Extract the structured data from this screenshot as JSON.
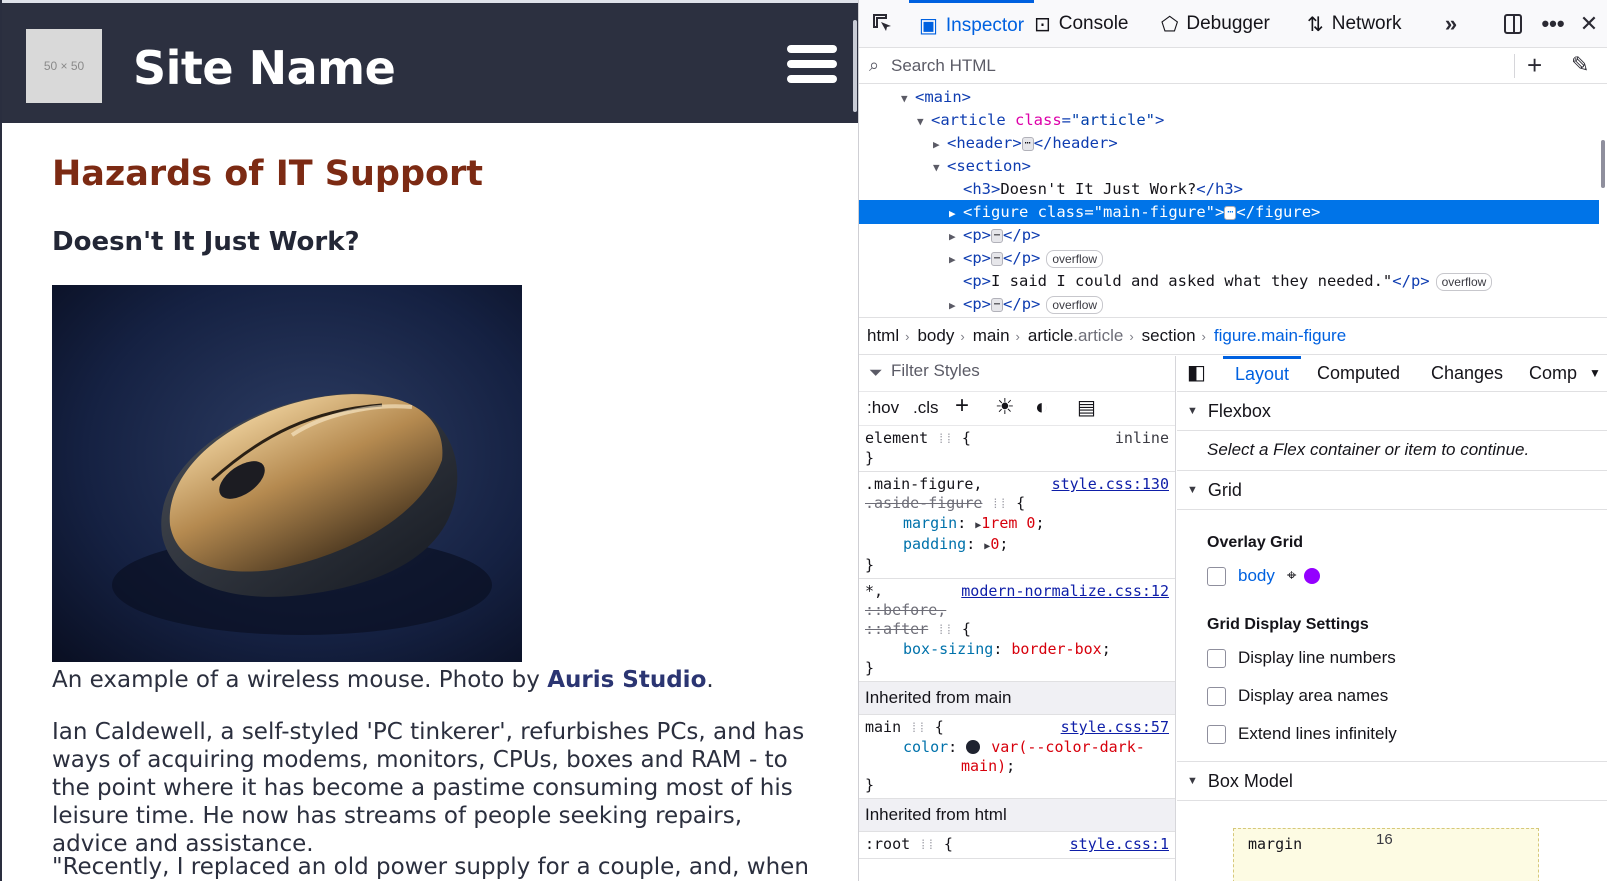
{
  "page": {
    "logo_text": "50 × 50",
    "site_name": "Site Name",
    "article_title": "Hazards of IT Support",
    "section_title": "Doesn't It Just Work?",
    "caption_text": "An example of a wireless mouse. Photo by ",
    "caption_link": "Auris Studio",
    "caption_end": ".",
    "para1": "Ian Caldewell, a self-styled 'PC tinkerer', refurbishes PCs, and has ways of acquiring modems, monitors, CPUs, boxes and RAM - to the point where it has become a pastime consuming most of his leisure time. He now has streams of people seeking repairs, advice and assistance.",
    "para2": "\"Recently, I replaced an old power supply for a couple, and, when they"
  },
  "devtools": {
    "tabs": {
      "inspector": "Inspector",
      "console": "Console",
      "debugger": "Debugger",
      "network": "Network"
    },
    "search_placeholder": "Search HTML",
    "markup": {
      "r1_tag": "<main>",
      "r2_open": "<article ",
      "r2_attn": "class",
      "r2_attv": "\"article\"",
      "r2_close": ">",
      "r3_open": "<header>",
      "r3_close": "</header>",
      "r4": "<section>",
      "r5_open": "<h3>",
      "r5_text": "Doesn't It Just Work?",
      "r5_close": "</h3>",
      "r6_open": "<figure ",
      "r6_attn": "class",
      "r6_attv": "\"main-figure\"",
      "r6_gt": ">",
      "r6_close": "</figure>",
      "p_open": "<p>",
      "p_close": "</p>",
      "r9_text": "I said I could and asked what they needed.\"",
      "badge": "overflow",
      "ellipsis": "⋯"
    },
    "breadcrumbs": {
      "c1": "html",
      "c2": "body",
      "c3": "main",
      "c4": "article",
      "c4_cls": ".article",
      "c5": "section",
      "c6": "figure.main-figure"
    },
    "rules": {
      "filter_placeholder": "Filter Styles",
      "hov": ":hov",
      "cls": ".cls",
      "element_sel": "element",
      "element_right": "inline",
      "r1_sel1": ".main-figure,",
      "r1_sel2": ".aside-figure",
      "r1_src": "style.css:130",
      "r1_p1": "margin",
      "r1_v1": "1rem 0",
      "r1_p2": "padding",
      "r1_v2": "0",
      "r2_sel1": "*,",
      "r2_sel2": "::before,",
      "r2_sel3": "::after",
      "r2_src": "modern-normalize.css:12",
      "r2_p1": "box-sizing",
      "r2_v1": "border-box",
      "inh_main": "Inherited from main",
      "r3_sel": "main",
      "r3_src": "style.css:57",
      "r3_p1": "color",
      "r3_v1a": "var(--color-dark-",
      "r3_v1b": "main)",
      "inh_html": "Inherited from html",
      "r4_sel": ":root",
      "r4_src": "style.css:1"
    },
    "layout": {
      "tabs": [
        "Layout",
        "Computed",
        "Changes",
        "Comp"
      ],
      "flexbox": "Flexbox",
      "flex_msg": "Select a Flex container or item to continue.",
      "grid": "Grid",
      "overlay_grid": "Overlay Grid",
      "body_link": "body",
      "grid_display_settings": "Grid Display Settings",
      "opt1": "Display line numbers",
      "opt2": "Display area names",
      "opt3": "Extend lines infinitely",
      "box_model": "Box Model",
      "margin_label": "margin",
      "margin_value": "16"
    },
    "colors": {
      "accent": "#0061e0",
      "grid_overlay": "#9400ff"
    }
  }
}
